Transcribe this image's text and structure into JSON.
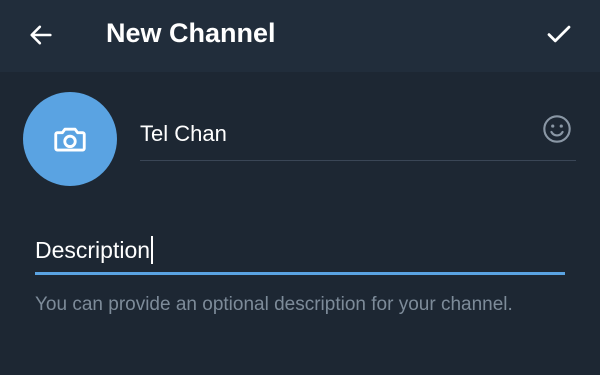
{
  "header": {
    "title": "New Channel",
    "back_icon": "arrow-left-icon",
    "done_icon": "check-icon"
  },
  "avatar": {
    "icon": "camera-icon",
    "color": "#5aa3e2"
  },
  "name_field": {
    "value": "Tel Chan",
    "emoji_icon": "smile-icon"
  },
  "description_field": {
    "value": "Description",
    "accent_color": "#5aa3e2"
  },
  "hint": {
    "text": "You can provide an optional description for your channel."
  },
  "colors": {
    "background": "#1d2733",
    "header": "#212d3b",
    "hint_text": "#7d8b99"
  }
}
